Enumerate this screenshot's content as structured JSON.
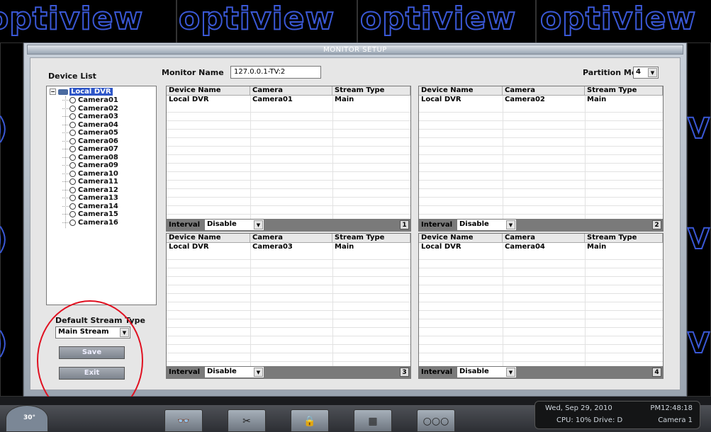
{
  "brand": {
    "words": [
      "optiview",
      "optiview",
      "optiview",
      "optiview"
    ],
    "accent_color": "#3a58d6"
  },
  "dialog": {
    "title": "MONITOR SETUP",
    "device_list_label": "Device List",
    "monitor_name_label": "Monitor Name",
    "monitor_name_value": "127.0.0.1-TV:2",
    "partition_mode_label": "Partition Mode",
    "partition_mode_value": "4",
    "tree": {
      "root": "Local DVR",
      "items": [
        "Camera01",
        "Camera02",
        "Camera03",
        "Camera04",
        "Camera05",
        "Camera06",
        "Camera07",
        "Camera08",
        "Camera09",
        "Camera10",
        "Camera11",
        "Camera12",
        "Camera13",
        "Camera14",
        "Camera15",
        "Camera16"
      ]
    },
    "default_stream_label": "Default Stream Type",
    "default_stream_value": "Main Stream",
    "save_label": "Save",
    "exit_label": "Exit",
    "columns": [
      "Device Name",
      "Camera",
      "Stream Type"
    ],
    "interval_label": "Interval",
    "panels": [
      {
        "number": "1",
        "device": "Local DVR",
        "camera": "Camera01",
        "stream": "Main",
        "interval": "Disable"
      },
      {
        "number": "2",
        "device": "Local DVR",
        "camera": "Camera02",
        "stream": "Main",
        "interval": "Disable"
      },
      {
        "number": "3",
        "device": "Local DVR",
        "camera": "Camera03",
        "stream": "Main",
        "interval": "Disable"
      },
      {
        "number": "4",
        "device": "Local DVR",
        "camera": "Camera04",
        "stream": "Main",
        "interval": "Disable"
      }
    ]
  },
  "taskbar": {
    "ptz_angle": "30°",
    "datetime": "Wed, Sep 29, 2010",
    "time": "PM12:48:18",
    "status": "CPU: 10%  Drive: D",
    "camera": "Camera 1",
    "icons": [
      "binoculars-icon",
      "tools-icon",
      "lock-icon",
      "network-icon",
      "more-icon"
    ]
  },
  "annotation_color": "#e01020"
}
